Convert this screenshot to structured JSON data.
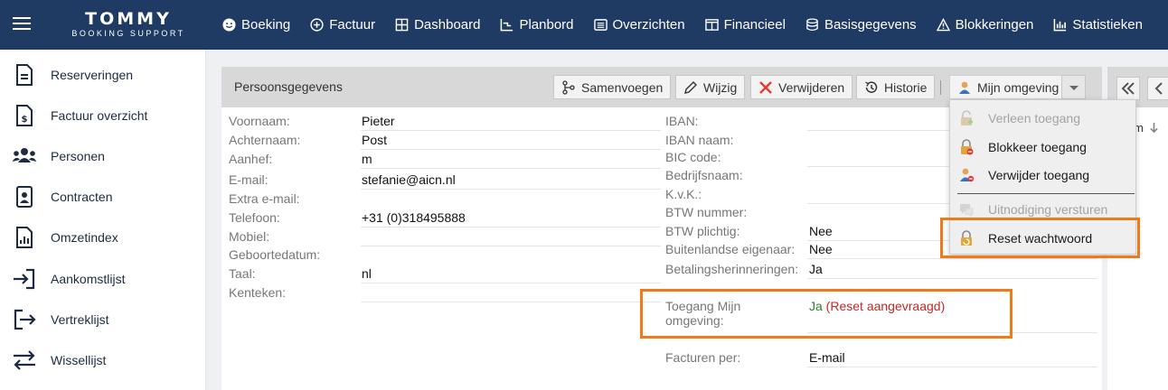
{
  "logo": {
    "brand": "TOMMY",
    "sub": "BOOKING SUPPORT"
  },
  "nav": [
    {
      "label": "Boeking",
      "icon": "smiley-icon"
    },
    {
      "label": "Factuur",
      "icon": "plus-circle-icon"
    },
    {
      "label": "Dashboard",
      "icon": "grid-icon"
    },
    {
      "label": "Planbord",
      "icon": "chart-line-icon"
    },
    {
      "label": "Overzichten",
      "icon": "list-icon"
    },
    {
      "label": "Financieel",
      "icon": "columns-icon"
    },
    {
      "label": "Basisgegevens",
      "icon": "database-icon"
    },
    {
      "label": "Blokkeringen",
      "icon": "warning-icon"
    },
    {
      "label": "Statistieken",
      "icon": "bar-chart-icon"
    }
  ],
  "sidebar": [
    {
      "label": "Reserveringen",
      "icon": "document-icon"
    },
    {
      "label": "Factuur overzicht",
      "icon": "invoice-icon"
    },
    {
      "label": "Personen",
      "icon": "people-icon"
    },
    {
      "label": "Contracten",
      "icon": "contract-icon"
    },
    {
      "label": "Omzetindex",
      "icon": "report-icon"
    },
    {
      "label": "Aankomstlijst",
      "icon": "sign-in-icon"
    },
    {
      "label": "Vertreklijst",
      "icon": "sign-out-icon"
    },
    {
      "label": "Wissellijst",
      "icon": "swap-icon"
    }
  ],
  "panel": {
    "title": "Persoonsgegevens",
    "toolbar": {
      "merge": "Samenvoegen",
      "edit": "Wijzig",
      "delete": "Verwijderen",
      "history": "Historie",
      "my_env": "Mijn omgeving"
    },
    "left_fields": [
      {
        "label": "Voornaam:",
        "value": "Pieter"
      },
      {
        "label": "Achternaam:",
        "value": "Post"
      },
      {
        "label": "Aanhef:",
        "value": "m"
      },
      {
        "label": "E-mail:",
        "value": "stefanie@aicn.nl"
      },
      {
        "label": "Extra e-mail:",
        "value": ""
      },
      {
        "label": "Telefoon:",
        "value": "+31 (0)318495888"
      },
      {
        "label": "Mobiel:",
        "value": ""
      },
      {
        "label": "Geboortedatum:",
        "value": ""
      },
      {
        "label": "Taal:",
        "value": "nl"
      },
      {
        "label": "Kenteken:",
        "value": ""
      }
    ],
    "right_fields": [
      {
        "label": "IBAN:",
        "value": ""
      },
      {
        "label": "IBAN naam:",
        "value": ""
      },
      {
        "label": "BIC code:",
        "value": ""
      },
      {
        "label": "Bedrijfsnaam:",
        "value": ""
      },
      {
        "label": "K.v.K.:",
        "value": ""
      },
      {
        "label": "BTW nummer:",
        "value": ""
      },
      {
        "label": "BTW plichtig:",
        "value": "Nee"
      },
      {
        "label": "Buitenlandse eigenaar:",
        "value": "Nee"
      },
      {
        "label": "Betalingsherinneringen:",
        "value": "Ja"
      }
    ],
    "access": {
      "label_line1": "Toegang Mijn",
      "label_line2": "omgeving:",
      "value": "Ja",
      "paren_open": " (",
      "reset": "Reset aangevraagd",
      "paren_close": ")"
    },
    "invoices": {
      "label": "Facturen per:",
      "value": "E-mail"
    }
  },
  "side_panel": {
    "text": "m"
  },
  "menu": {
    "grant": "Verleen toegang",
    "block": "Blokkeer toegang",
    "remove": "Verwijder toegang",
    "invite": "Uitnodiging versturen",
    "reset": "Reset wachtwoord"
  },
  "colors": {
    "topbar": "#1f3a63",
    "highlight": "#f07a1a",
    "access_yes": "#2e7d32",
    "access_reset": "#c62828"
  }
}
